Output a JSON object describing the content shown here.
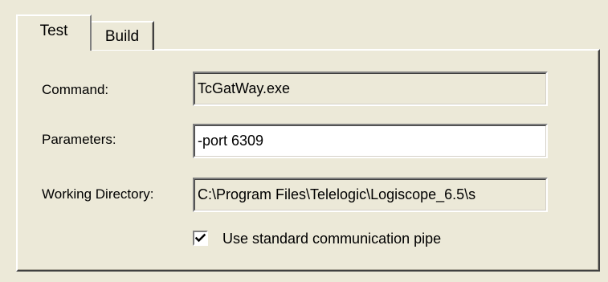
{
  "tabs": [
    {
      "label": "Test",
      "active": true
    },
    {
      "label": "Build",
      "active": false
    }
  ],
  "form": {
    "command": {
      "label": "Command:",
      "value": "TcGatWay.exe",
      "editable": false
    },
    "parameters": {
      "label": "Parameters:",
      "value": "-port 6309",
      "editable": true
    },
    "working_directory": {
      "label": "Working Directory:",
      "value": "C:\\Program Files\\Telelogic\\Logiscope_6.5\\s",
      "editable": false
    },
    "use_pipe": {
      "label": "Use standard communication pipe",
      "checked": true
    }
  },
  "colors": {
    "dialog_bg": "#ece9d8",
    "field_readonly_bg": "#ece9d8",
    "field_editable_bg": "#ffffff"
  },
  "icons": {
    "checkmark": "checkmark-icon"
  }
}
